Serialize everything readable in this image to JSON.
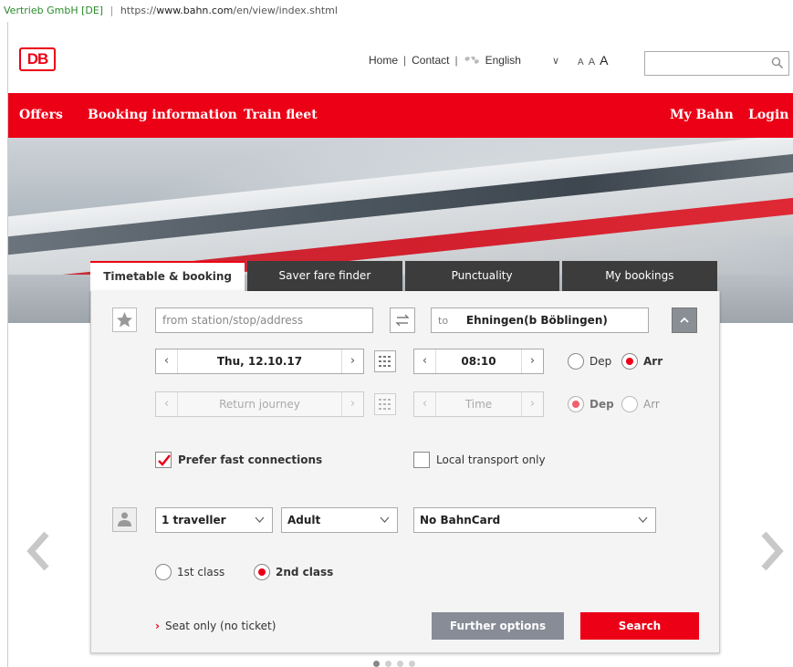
{
  "browser": {
    "cert_owner": "Vertrieb GmbH [DE]",
    "url_scheme": "https://",
    "url_host": "www.bahn.com",
    "url_path": "/en/view/index.shtml"
  },
  "header": {
    "logo": "DB",
    "home": "Home",
    "contact": "Contact",
    "language": "English",
    "font_sizes": [
      "A",
      "A",
      "A"
    ],
    "search_value": ""
  },
  "nav": {
    "offers": "Offers",
    "booking_info": "Booking information",
    "train_fleet": "Train fleet",
    "my_bahn": "My Bahn",
    "login": "Login"
  },
  "tabs": [
    "Timetable & booking",
    "Saver fare finder",
    "Punctuality",
    "My bookings"
  ],
  "form": {
    "from_placeholder": "from station/stop/address",
    "to_label": "to",
    "to_value": "Ehningen(b Böblingen)",
    "outbound_date": "Thu, 12.10.17",
    "outbound_time": "08:10",
    "dep": "Dep",
    "arr": "Arr",
    "return_journey": "Return journey",
    "return_time": "Time",
    "prefer_fast": "Prefer fast connections",
    "local_only": "Local transport only",
    "travellers": "1 traveller",
    "age": "Adult",
    "bahncard": "No BahnCard",
    "first_class": "1st class",
    "second_class": "2nd class",
    "seat_only": "Seat only (no ticket)",
    "further_options": "Further options",
    "search": "Search"
  },
  "colors": {
    "brand_red": "#ec0016",
    "tab_dark": "#3c3c3c",
    "button_grey": "#878c96"
  }
}
